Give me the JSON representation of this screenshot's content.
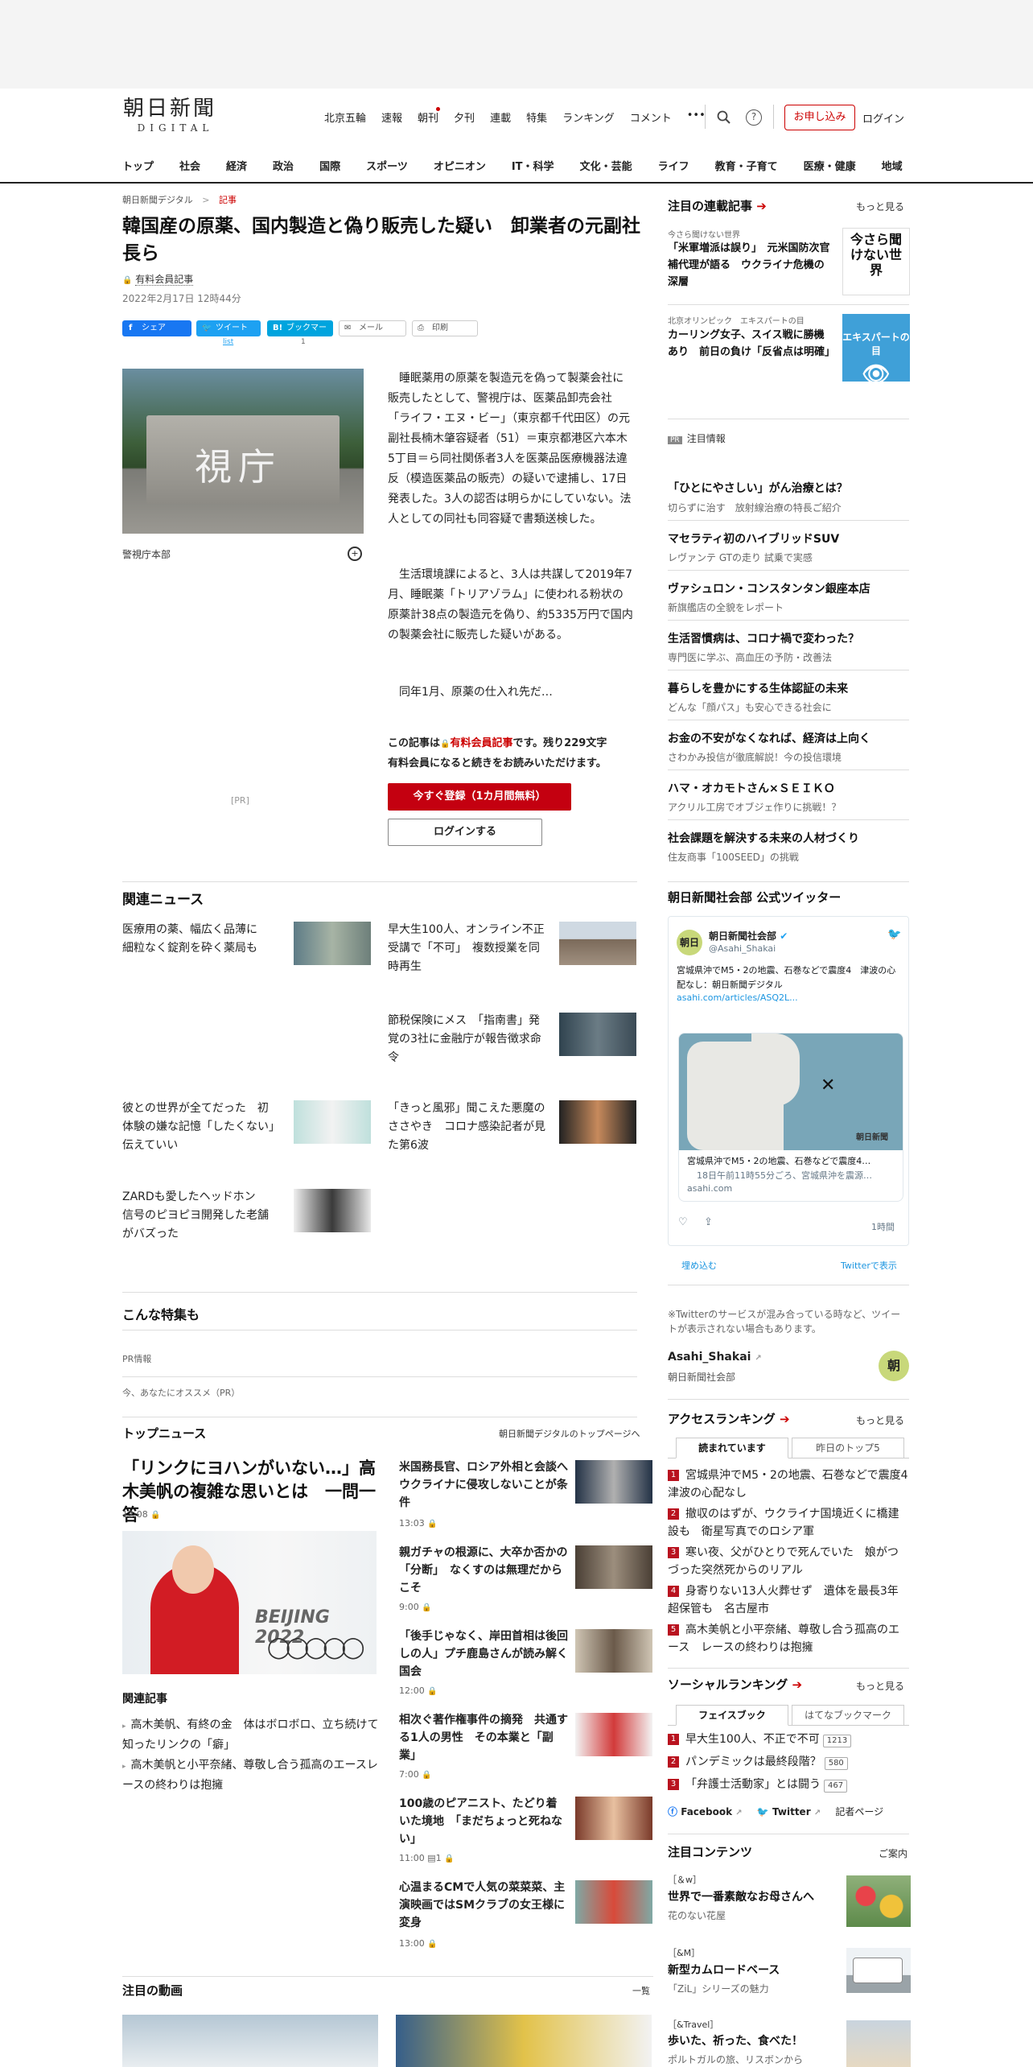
{
  "brand": {
    "logo_jp": "朝日新聞",
    "logo_en": "DIGITAL"
  },
  "topnav": [
    "北京五輪",
    "速報",
    "朝刊",
    "夕刊",
    "連載",
    "特集",
    "ランキング",
    "コメント",
    "•••"
  ],
  "header": {
    "apply": "お申し込み",
    "login": "ログイン"
  },
  "catnav": [
    "トップ",
    "社会",
    "経済",
    "政治",
    "国際",
    "スポーツ",
    "オピニオン",
    "IT・科学",
    "文化・芸能",
    "ライフ",
    "教育・子育て",
    "医療・健康",
    "地域"
  ],
  "breadcrumb": {
    "home": "朝日新聞デジタル",
    "sep": ">",
    "current": "記事"
  },
  "article": {
    "title": "韓国産の原薬、国内製造と偽り販売した疑い　卸業者の元副社長ら",
    "paid": "有料会員記事",
    "date": "2022年2月17日 12時44分",
    "share": {
      "fb": "シェア",
      "tw": "ツイート",
      "tw_count": "list",
      "hb": "ブックマーク",
      "hb_count": "1",
      "mail": "メール",
      "print": "印刷"
    },
    "photo_sign": "視庁",
    "caption": "警視庁本部",
    "p1": "睡眠薬用の原薬を製造元を偽って製薬会社に販売したとして、警視庁は、医薬品卸売会社「ライフ・エヌ・ビー」（東京都千代田区）の元副社長楠木肇容疑者（51）＝東京都港区六本木5丁目＝ら同社関係者3人を医薬品医療機器法違反（模造医薬品の販売）の疑いで逮捕し、17日発表した。3人の認否は明らかにしていない。法人としての同社も同容疑で書類送検した。",
    "p2": "生活環境課によると、3人は共謀して2019年7月、睡眠薬「トリアゾラム」に使われる粉状の原薬計38点の製造元を偽り、約5335万円で国内の製薬会社に販売した疑いがある。",
    "p3": "同年1月、原薬の仕入れ先だ…",
    "pr": "[PR]",
    "paywall_1a": "この記事は",
    "paywall_1b": "有料会員記事",
    "paywall_1c": "です。残り229文字",
    "paywall_2": "有料会員になると続きをお読みいただけます。",
    "register": "今すぐ登録（1カ月間無料）",
    "loginbtn": "ログインする"
  },
  "related": {
    "heading": "関連ニュース",
    "items": [
      "医療用の薬、幅広く品薄に　細粒なく錠剤を砕く薬局も",
      "早大生100人、オンライン不正受講で「不可」　複数授業を同時再生",
      "節税保険にメス　「指南書」発覚の3社に金融庁が報告徴求命令",
      "彼との世界が全てだった　初体験の嫌な記憶「したくない」伝えていい",
      "「きっと風邪」聞こえた悪魔のささやき　コロナ感染記者が見た第6波",
      "ZARDも愛したヘッドホン　信号のピヨピヨ開発した老舗がバズった"
    ]
  },
  "feature": {
    "heading": "こんな特集も",
    "pr1": "PR情報",
    "pr2": "今、あなたにオススメ（PR）"
  },
  "topnews": {
    "heading": "トップニュース",
    "more": "朝日新聞デジタルのトップページへ",
    "lead": "「リンクにヨハンがいない…」高木美帆の複雑な思いとは　一問一答",
    "lead_time": "12:08",
    "photo_text": "BEIJING 2022",
    "rel_head": "関連記事",
    "rel": [
      "高木美帆、有終の金　体はボロボロ、立ち続けて知ったリンクの「癖」",
      "高木美帆と小平奈緒、尊敬し合う孤高のエースレースの終わりは抱擁"
    ],
    "items": [
      {
        "t": "米国務長官、ロシア外相と会談へ　ウクライナに侵攻しないことが条件",
        "time": "13:03"
      },
      {
        "t": "親ガチャの根源に、大卒か否かの「分断」　なくすのは無理だからこそ",
        "time": "9:00"
      },
      {
        "t": "「後手じゃなく、岸田首相は後回しの人」プチ鹿島さんが読み解く国会",
        "time": "12:00"
      },
      {
        "t": "相次ぐ著作権事件の摘発　共通する1人の男性　その本業と「副業」",
        "time": "7:00"
      },
      {
        "t": "100歳のピアニスト、たどり着いた境地　「まだちょっと死ねない」",
        "time": "11:00"
      },
      {
        "t": "心温まるCMで人気の菜菜菜、主演映画ではSMクラブの女王様に変身",
        "time": "13:00"
      }
    ]
  },
  "videos": {
    "heading": "注目の動画",
    "more": "一覧"
  },
  "sidebar": {
    "series": {
      "heading": "注目の連載記事",
      "more": "もっと見る",
      "i1_cat": "今さら聞けない世界",
      "i1": "「米軍増派は誤り」　元米国防次官補代理が語る　ウクライナ危機の深層",
      "i1_thumb": "今さら聞けない世界",
      "i2_cat": "北京オリンピック　エキスパートの目",
      "i2": "カーリング女子、スイス戦に勝機あり　前日の負け「反省点は明確」",
      "i2_thumb": "エキスパートの目"
    },
    "pr": {
      "label": "PR",
      "heading": "注目情報",
      "items": [
        {
          "t": "「ひとにやさしい」がん治療とは？",
          "s": "切らずに治す　放射線治療の特長ご紹介"
        },
        {
          "t": "マセラティ初のハイブリッドSUV",
          "s": "レヴァンテ GTの走り 試乗で実感"
        },
        {
          "t": "ヴァシュロン・コンスタンタン銀座本店",
          "s": "新旗艦店の全貌をレポート"
        },
        {
          "t": "生活習慣病は、コロナ禍で変わった？",
          "s": "専門医に学ぶ、高血圧の予防・改善法"
        },
        {
          "t": "暮らしを豊かにする生体認証の未来",
          "s": "どんな「顔パス」も安心できる社会に"
        },
        {
          "t": "お金の不安がなくなれば、経済は上向く",
          "s": "さわかみ投信が徹底解説！今の投信環境"
        },
        {
          "t": "ハマ・オカモトさん×ＳＥＩＫＯ",
          "s": "アクリル工房でオブジェ作りに挑戦！？"
        },
        {
          "t": "社会課題を解決する未来の人材づくり",
          "s": "住友商事「100SEED」の挑戦"
        }
      ]
    },
    "twitter": {
      "heading": "朝日新聞社会部 公式ツイッター",
      "name": "朝日新聞社会部",
      "handle": "@Asahi_Shakai",
      "avatar": "朝日",
      "text": "宮城県沖でM5・2の地震、石巻などで震度4　津波の心配なし：朝日新聞デジタル",
      "link": "asahi.com/articles/ASQ2L...",
      "card_title": "宮城県沖でM5・2の地震、石巻などで震度4…",
      "card_desc": "18日午前11時55分ごろ、宮城県沖を震源…",
      "card_domain": "asahi.com",
      "card_brand": "朝日新聞",
      "time": "1時間",
      "embed": "埋め込む",
      "view": "Twitterで表示",
      "note": "※Twitterのサービスが混み合っている時など、ツイートが表示されない場合もあります。",
      "acct": "Asahi_Shakai",
      "acct_sub": "朝日新聞社会部",
      "acct_icon": "朝"
    },
    "access": {
      "heading": "アクセスランキング",
      "more": "もっと見る",
      "tab1": "読まれています",
      "tab2": "昨日のトップ5",
      "items": [
        "宮城県沖でM5・2の地震、石巻などで震度4　津波の心配なし",
        "撤収のはずが、ウクライナ国境近くに橋建設も　衛星写真でのロシア軍",
        "寒い夜、父がひとりで死んでいた　娘がつづった突然死からのリアル",
        "身寄りない13人火葬せず　遺体を最長3年超保管も　名古屋市",
        "高木美帆と小平奈緒、尊敬し合う孤高のエース　レースの終わりは抱擁"
      ]
    },
    "social": {
      "heading": "ソーシャルランキング",
      "more": "もっと見る",
      "tab1": "フェイスブック",
      "tab2": "はてなブックマーク",
      "items": [
        {
          "t": "早大生100人、不正で不可",
          "c": "1213"
        },
        {
          "t": "パンデミックは最終段階？",
          "c": "580"
        },
        {
          "t": "「弁護士活動家」とは闘う",
          "c": "467"
        }
      ],
      "fb": "Facebook",
      "tw": "Twitter",
      "reporter": "記者ページ"
    },
    "contents": {
      "heading": "注目コンテンツ",
      "more": "ご案内",
      "items": [
        {
          "c": "［＆w］",
          "t": "世界で一番素敵なお母さんへ",
          "s": "花のない花屋"
        },
        {
          "c": "［&M］",
          "t": "新型カムロードベース",
          "s": "「ZiL」シリーズの魅力"
        },
        {
          "c": "［&Travel］",
          "t": "歩いた、祈った、食べた！",
          "s": "ポルトガルの旅、リスボンから"
        }
      ]
    }
  },
  "colors": {
    "brand_red": "#c40010",
    "twitter": "#1da1f2",
    "facebook": "#1877f2",
    "hatena": "#00a4de"
  }
}
